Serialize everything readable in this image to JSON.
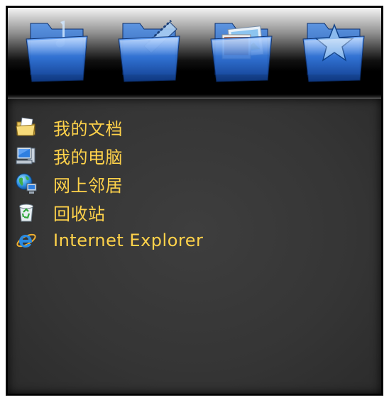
{
  "header": {
    "folders": [
      {
        "icon": "music-folder-icon"
      },
      {
        "icon": "video-folder-icon"
      },
      {
        "icon": "pictures-folder-icon"
      },
      {
        "icon": "favorites-folder-icon"
      }
    ]
  },
  "items": [
    {
      "label": "我的文档",
      "icon": "my-documents-icon"
    },
    {
      "label": "我的电脑",
      "icon": "my-computer-icon"
    },
    {
      "label": "网上邻居",
      "icon": "network-places-icon"
    },
    {
      "label": "回收站",
      "icon": "recycle-bin-icon"
    },
    {
      "label": "Internet Explorer",
      "icon": "internet-explorer-icon"
    }
  ],
  "colors": {
    "label": "#ffd24a",
    "folder_blue": "#2f6fd0",
    "content_bg": "#363636"
  }
}
